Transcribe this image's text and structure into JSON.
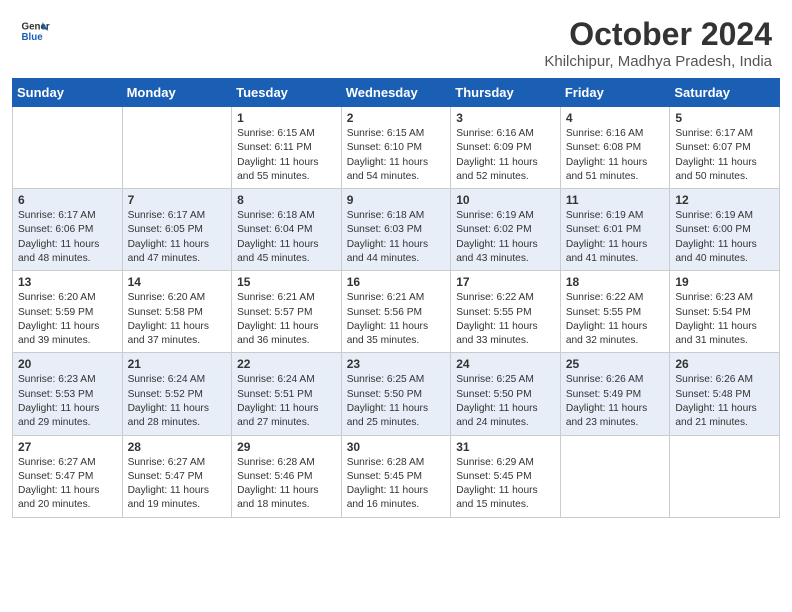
{
  "header": {
    "logo_line1": "General",
    "logo_line2": "Blue",
    "month": "October 2024",
    "location": "Khilchipur, Madhya Pradesh, India"
  },
  "weekdays": [
    "Sunday",
    "Monday",
    "Tuesday",
    "Wednesday",
    "Thursday",
    "Friday",
    "Saturday"
  ],
  "weeks": [
    [
      {
        "day": "",
        "sunrise": "",
        "sunset": "",
        "daylight": ""
      },
      {
        "day": "",
        "sunrise": "",
        "sunset": "",
        "daylight": ""
      },
      {
        "day": "1",
        "sunrise": "Sunrise: 6:15 AM",
        "sunset": "Sunset: 6:11 PM",
        "daylight": "Daylight: 11 hours and 55 minutes."
      },
      {
        "day": "2",
        "sunrise": "Sunrise: 6:15 AM",
        "sunset": "Sunset: 6:10 PM",
        "daylight": "Daylight: 11 hours and 54 minutes."
      },
      {
        "day": "3",
        "sunrise": "Sunrise: 6:16 AM",
        "sunset": "Sunset: 6:09 PM",
        "daylight": "Daylight: 11 hours and 52 minutes."
      },
      {
        "day": "4",
        "sunrise": "Sunrise: 6:16 AM",
        "sunset": "Sunset: 6:08 PM",
        "daylight": "Daylight: 11 hours and 51 minutes."
      },
      {
        "day": "5",
        "sunrise": "Sunrise: 6:17 AM",
        "sunset": "Sunset: 6:07 PM",
        "daylight": "Daylight: 11 hours and 50 minutes."
      }
    ],
    [
      {
        "day": "6",
        "sunrise": "Sunrise: 6:17 AM",
        "sunset": "Sunset: 6:06 PM",
        "daylight": "Daylight: 11 hours and 48 minutes."
      },
      {
        "day": "7",
        "sunrise": "Sunrise: 6:17 AM",
        "sunset": "Sunset: 6:05 PM",
        "daylight": "Daylight: 11 hours and 47 minutes."
      },
      {
        "day": "8",
        "sunrise": "Sunrise: 6:18 AM",
        "sunset": "Sunset: 6:04 PM",
        "daylight": "Daylight: 11 hours and 45 minutes."
      },
      {
        "day": "9",
        "sunrise": "Sunrise: 6:18 AM",
        "sunset": "Sunset: 6:03 PM",
        "daylight": "Daylight: 11 hours and 44 minutes."
      },
      {
        "day": "10",
        "sunrise": "Sunrise: 6:19 AM",
        "sunset": "Sunset: 6:02 PM",
        "daylight": "Daylight: 11 hours and 43 minutes."
      },
      {
        "day": "11",
        "sunrise": "Sunrise: 6:19 AM",
        "sunset": "Sunset: 6:01 PM",
        "daylight": "Daylight: 11 hours and 41 minutes."
      },
      {
        "day": "12",
        "sunrise": "Sunrise: 6:19 AM",
        "sunset": "Sunset: 6:00 PM",
        "daylight": "Daylight: 11 hours and 40 minutes."
      }
    ],
    [
      {
        "day": "13",
        "sunrise": "Sunrise: 6:20 AM",
        "sunset": "Sunset: 5:59 PM",
        "daylight": "Daylight: 11 hours and 39 minutes."
      },
      {
        "day": "14",
        "sunrise": "Sunrise: 6:20 AM",
        "sunset": "Sunset: 5:58 PM",
        "daylight": "Daylight: 11 hours and 37 minutes."
      },
      {
        "day": "15",
        "sunrise": "Sunrise: 6:21 AM",
        "sunset": "Sunset: 5:57 PM",
        "daylight": "Daylight: 11 hours and 36 minutes."
      },
      {
        "day": "16",
        "sunrise": "Sunrise: 6:21 AM",
        "sunset": "Sunset: 5:56 PM",
        "daylight": "Daylight: 11 hours and 35 minutes."
      },
      {
        "day": "17",
        "sunrise": "Sunrise: 6:22 AM",
        "sunset": "Sunset: 5:55 PM",
        "daylight": "Daylight: 11 hours and 33 minutes."
      },
      {
        "day": "18",
        "sunrise": "Sunrise: 6:22 AM",
        "sunset": "Sunset: 5:55 PM",
        "daylight": "Daylight: 11 hours and 32 minutes."
      },
      {
        "day": "19",
        "sunrise": "Sunrise: 6:23 AM",
        "sunset": "Sunset: 5:54 PM",
        "daylight": "Daylight: 11 hours and 31 minutes."
      }
    ],
    [
      {
        "day": "20",
        "sunrise": "Sunrise: 6:23 AM",
        "sunset": "Sunset: 5:53 PM",
        "daylight": "Daylight: 11 hours and 29 minutes."
      },
      {
        "day": "21",
        "sunrise": "Sunrise: 6:24 AM",
        "sunset": "Sunset: 5:52 PM",
        "daylight": "Daylight: 11 hours and 28 minutes."
      },
      {
        "day": "22",
        "sunrise": "Sunrise: 6:24 AM",
        "sunset": "Sunset: 5:51 PM",
        "daylight": "Daylight: 11 hours and 27 minutes."
      },
      {
        "day": "23",
        "sunrise": "Sunrise: 6:25 AM",
        "sunset": "Sunset: 5:50 PM",
        "daylight": "Daylight: 11 hours and 25 minutes."
      },
      {
        "day": "24",
        "sunrise": "Sunrise: 6:25 AM",
        "sunset": "Sunset: 5:50 PM",
        "daylight": "Daylight: 11 hours and 24 minutes."
      },
      {
        "day": "25",
        "sunrise": "Sunrise: 6:26 AM",
        "sunset": "Sunset: 5:49 PM",
        "daylight": "Daylight: 11 hours and 23 minutes."
      },
      {
        "day": "26",
        "sunrise": "Sunrise: 6:26 AM",
        "sunset": "Sunset: 5:48 PM",
        "daylight": "Daylight: 11 hours and 21 minutes."
      }
    ],
    [
      {
        "day": "27",
        "sunrise": "Sunrise: 6:27 AM",
        "sunset": "Sunset: 5:47 PM",
        "daylight": "Daylight: 11 hours and 20 minutes."
      },
      {
        "day": "28",
        "sunrise": "Sunrise: 6:27 AM",
        "sunset": "Sunset: 5:47 PM",
        "daylight": "Daylight: 11 hours and 19 minutes."
      },
      {
        "day": "29",
        "sunrise": "Sunrise: 6:28 AM",
        "sunset": "Sunset: 5:46 PM",
        "daylight": "Daylight: 11 hours and 18 minutes."
      },
      {
        "day": "30",
        "sunrise": "Sunrise: 6:28 AM",
        "sunset": "Sunset: 5:45 PM",
        "daylight": "Daylight: 11 hours and 16 minutes."
      },
      {
        "day": "31",
        "sunrise": "Sunrise: 6:29 AM",
        "sunset": "Sunset: 5:45 PM",
        "daylight": "Daylight: 11 hours and 15 minutes."
      },
      {
        "day": "",
        "sunrise": "",
        "sunset": "",
        "daylight": ""
      },
      {
        "day": "",
        "sunrise": "",
        "sunset": "",
        "daylight": ""
      }
    ]
  ]
}
